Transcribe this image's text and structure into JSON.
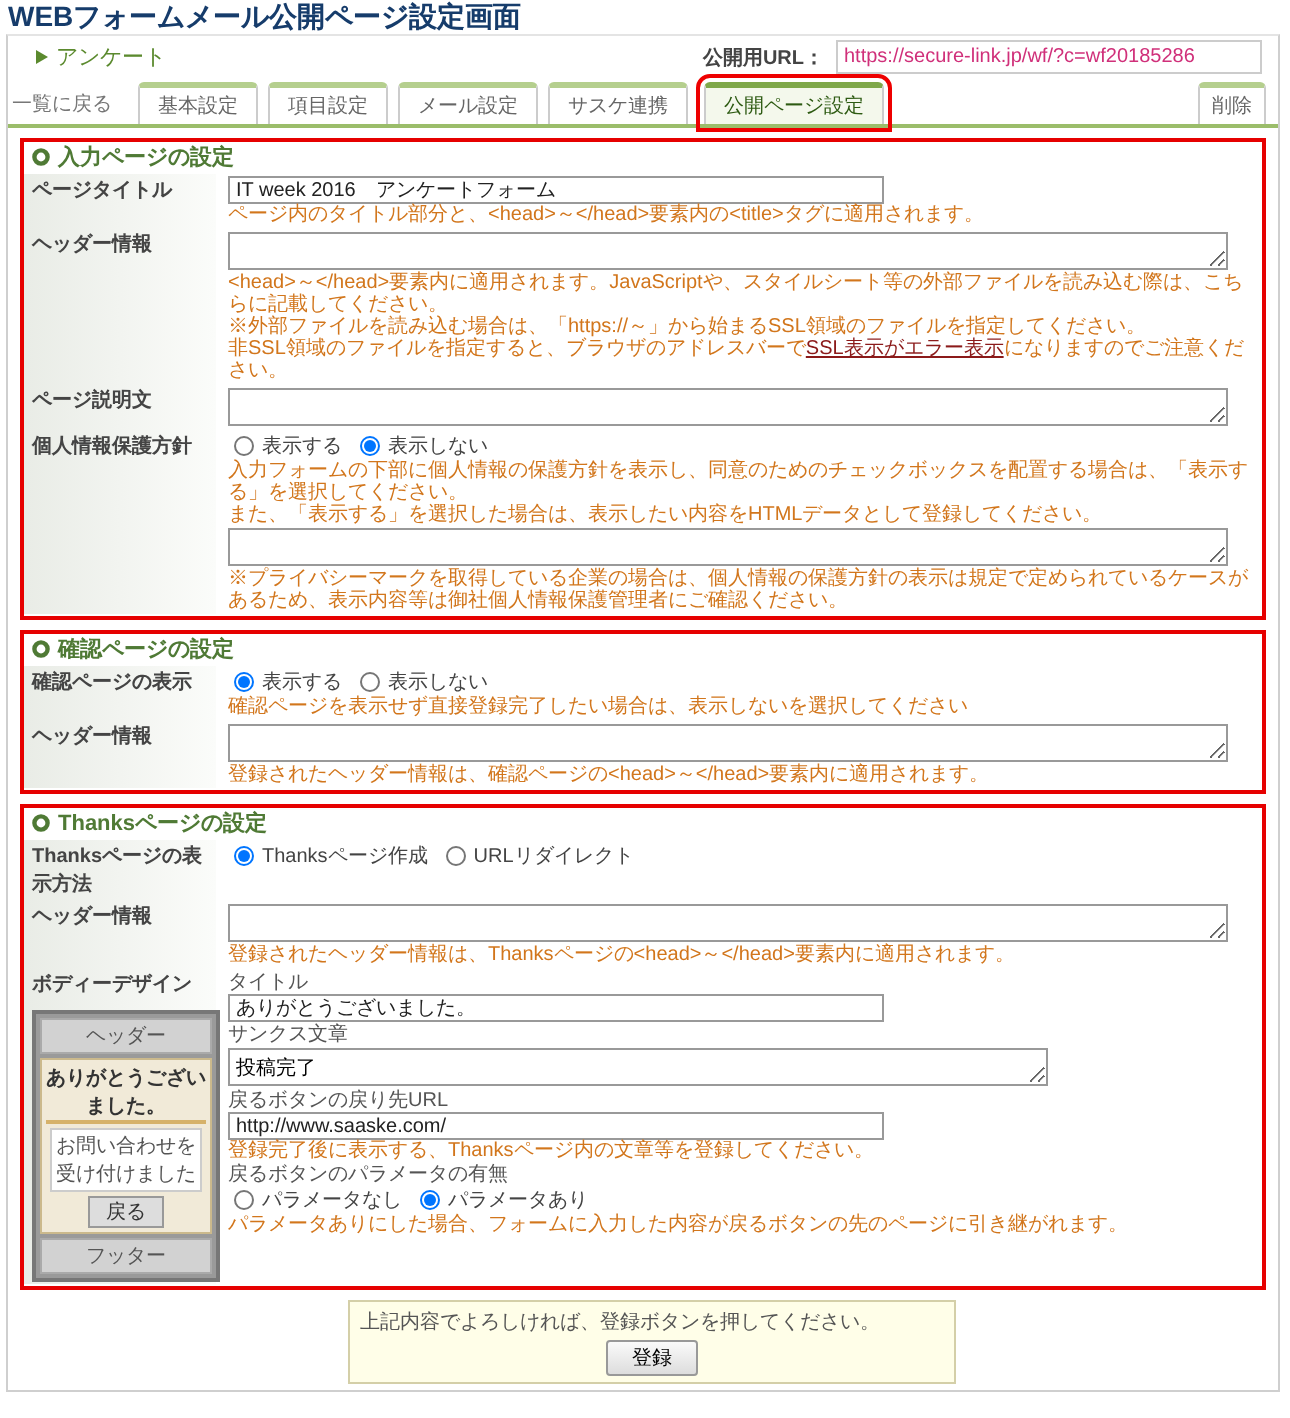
{
  "page_title": "WEBフォームメール公開ページ設定画面",
  "header": {
    "form_name": "アンケート",
    "url_label": "公開用URL：",
    "url_value": "https://secure-link.jp/wf/?c=wf20185286"
  },
  "nav": {
    "back_link": "一覧に戻る",
    "delete_button": "削除",
    "tabs": [
      {
        "label": "基本設定",
        "selected": false
      },
      {
        "label": "項目設定",
        "selected": false
      },
      {
        "label": "メール設定",
        "selected": false
      },
      {
        "label": "サスケ連携",
        "selected": false
      },
      {
        "label": "公開ページ設定",
        "selected": true
      }
    ]
  },
  "sections": [
    {
      "title": "入力ページの設定",
      "rows": [
        {
          "label": "ページタイトル",
          "items": [
            {
              "kind": "input",
              "value": "IT week 2016　アンケートフォーム"
            },
            {
              "kind": "note",
              "text": "ページ内のタイトル部分と、<head>～</head>要素内の<title>タグに適用されます。"
            }
          ]
        },
        {
          "label": "ヘッダー情報",
          "items": [
            {
              "kind": "textarea"
            },
            {
              "kind": "note",
              "text": "<head>～</head>要素内に適用されます。JavaScriptや、スタイルシート等の外部ファイルを読み込む際は、こちらに記載してください。"
            },
            {
              "kind": "note",
              "text": "※外部ファイルを読み込む場合は、「https://～」から始まるSSL領域のファイルを指定してください。"
            },
            {
              "kind": "note_link",
              "before": "非SSL領域のファイルを指定すると、ブラウザのアドレスバーで",
              "link": "SSL表示がエラー表示",
              "after": "になりますのでご注意ください。"
            }
          ]
        },
        {
          "label": "ページ説明文",
          "items": [
            {
              "kind": "textarea"
            }
          ]
        },
        {
          "label": "個人情報保護方針",
          "items": [
            {
              "kind": "radios",
              "options": [
                {
                  "label": "表示する",
                  "selected": false
                },
                {
                  "label": "表示しない",
                  "selected": true
                }
              ]
            },
            {
              "kind": "note",
              "text": "入力フォームの下部に個人情報の保護方針を表示し、同意のためのチェックボックスを配置する場合は、「表示する」を選択してください。"
            },
            {
              "kind": "note",
              "text": "また、「表示する」を選択した場合は、表示したい内容をHTMLデータとして登録してください。"
            },
            {
              "kind": "textarea"
            },
            {
              "kind": "note",
              "text": "※プライバシーマークを取得している企業の場合は、個人情報の保護方針の表示は規定で定められているケースがあるため、表示内容等は御社個人情報保護管理者にご確認ください。"
            }
          ]
        }
      ]
    },
    {
      "title": "確認ページの設定",
      "rows": [
        {
          "label": "確認ページの表示",
          "items": [
            {
              "kind": "radios",
              "options": [
                {
                  "label": "表示する",
                  "selected": true
                },
                {
                  "label": "表示しない",
                  "selected": false
                }
              ]
            },
            {
              "kind": "note",
              "text": "確認ページを表示せず直接登録完了したい場合は、表示しないを選択してください"
            }
          ]
        },
        {
          "label": "ヘッダー情報",
          "items": [
            {
              "kind": "textarea"
            },
            {
              "kind": "note",
              "text": "登録されたヘッダー情報は、確認ページの<head>～</head>要素内に適用されます。"
            }
          ]
        }
      ]
    },
    {
      "title": "Thanksページの設定",
      "rows": [
        {
          "label": "Thanksページの表示方法",
          "items": [
            {
              "kind": "radios",
              "options": [
                {
                  "label": "Thanksページ作成",
                  "selected": true
                },
                {
                  "label": "URLリダイレクト",
                  "selected": false
                }
              ]
            }
          ]
        },
        {
          "label": "ヘッダー情報",
          "items": [
            {
              "kind": "textarea"
            },
            {
              "kind": "note",
              "text": "登録されたヘッダー情報は、Thanksページの<head>～</head>要素内に適用されます。"
            }
          ]
        },
        {
          "label": "ボディーデザイン",
          "preview": {
            "header": "ヘッダー",
            "title": "ありがとうございました。",
            "message_lines": [
              "お問い合わせを",
              "受け付けました"
            ],
            "button": "戻る",
            "footer": "フッター"
          },
          "items": [
            {
              "kind": "field_label",
              "text": "タイトル"
            },
            {
              "kind": "input",
              "value": "ありがとうございました。"
            },
            {
              "kind": "field_label",
              "text": "サンクス文章"
            },
            {
              "kind": "textarea",
              "value": "投稿完了"
            },
            {
              "kind": "field_label",
              "text": "戻るボタンの戻り先URL"
            },
            {
              "kind": "input",
              "value": "http://www.saaske.com/"
            },
            {
              "kind": "note",
              "text": "登録完了後に表示する、Thanksページ内の文章等を登録してください。"
            },
            {
              "kind": "field_label",
              "text": "戻るボタンのパラメータの有無"
            },
            {
              "kind": "radios",
              "options": [
                {
                  "label": "パラメータなし",
                  "selected": false
                },
                {
                  "label": "パラメータあり",
                  "selected": true
                }
              ]
            },
            {
              "kind": "note",
              "text": "パラメータありにした場合、フォームに入力した内容が戻るボタンの先のページに引き継がれます。"
            }
          ]
        }
      ]
    }
  ],
  "footer": {
    "message": "上記内容でよろしければ、登録ボタンを押してください。",
    "button": "登録"
  }
}
